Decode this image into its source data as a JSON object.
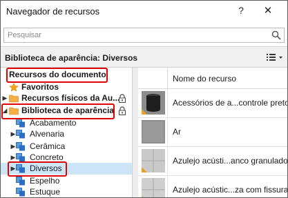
{
  "window": {
    "title": "Navegador de recursos",
    "help_label": "?",
    "close_label": "✕"
  },
  "search": {
    "placeholder": "Pesquisar"
  },
  "library_bar": {
    "title": "Biblioteca de aparência: Diversos"
  },
  "tree": {
    "items": [
      {
        "label": "Recursos do documento",
        "bold": true,
        "icon": "none"
      },
      {
        "label": "Favoritos",
        "bold": true,
        "icon": "star-icon"
      },
      {
        "label": "Recursos físicos da Au...",
        "bold": true,
        "icon": "folder-icon",
        "expander": "collapsed",
        "locked": true
      },
      {
        "label": "Biblioteca de aparência",
        "bold": true,
        "icon": "folder-icon",
        "expander": "expanded",
        "locked": true
      },
      {
        "label": "Acabamento",
        "icon": "category-icon"
      },
      {
        "label": "Alvenaria",
        "icon": "category-icon",
        "expander": "collapsed"
      },
      {
        "label": "Cerâmica",
        "icon": "category-icon",
        "expander": "collapsed"
      },
      {
        "label": "Concreto",
        "icon": "category-icon",
        "expander": "collapsed"
      },
      {
        "label": "Diversos",
        "icon": "category-icon",
        "expander": "collapsed",
        "selected": true
      },
      {
        "label": "Espelho",
        "icon": "category-icon"
      },
      {
        "label": "Estuque",
        "icon": "category-icon"
      }
    ]
  },
  "grid": {
    "column_header": "Nome do recurso",
    "rows": [
      {
        "name": "Acessórios de a...controle preto"
      },
      {
        "name": "Ar"
      },
      {
        "name": "Azulejo acústi...anco granulado"
      },
      {
        "name": "Azulejo acústic...za com fissuras"
      }
    ]
  },
  "colors": {
    "selection": "#cde6f7",
    "highlight_box": "#e00000",
    "folder": "#f0a030",
    "category": "#2b6cc4"
  }
}
